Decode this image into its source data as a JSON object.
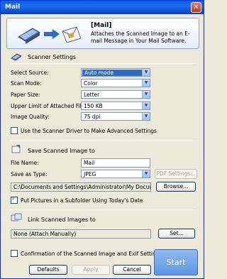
{
  "window": {
    "title": "Mail",
    "close_glyph": "✕"
  },
  "header": {
    "title": "[Mail]",
    "description": "Attaches the Scanned Image to an E-mail Message in Your Mail Software.",
    "scanner_icon": "scanner-icon",
    "arrow_icon": "arrow-right-icon",
    "mail_icon": "mail-envelope-icon"
  },
  "scanner_settings": {
    "heading": "Scanner Settings",
    "select_source": {
      "label": "Select Source:",
      "value": "Auto mode"
    },
    "scan_mode": {
      "label": "Scan Mode:",
      "value": "Color"
    },
    "paper_size": {
      "label": "Paper Size:",
      "value": "Letter"
    },
    "upper_limit": {
      "label": "Upper Limit of Attached File:",
      "value": "150 KB"
    },
    "image_quality": {
      "label": "Image Quality:",
      "value": "75 dpi"
    },
    "use_driver_label": "Use the Scanner Driver to Make Advanced Settings",
    "use_driver_checked": false
  },
  "save_settings": {
    "heading": "Save Scanned Image to",
    "file_name": {
      "label": "File Name:",
      "value": "Mail"
    },
    "save_as_type": {
      "label": "Save as Type:",
      "value": "JPEG"
    },
    "pdf_settings_label": "PDF Settings...",
    "save_path": "C:\\Documents and Settings\\Administrator\\My Documents\\My",
    "browse_label": "Browse...",
    "subfolder_label": "Put Pictures in a Subfolder Using Today's Date",
    "subfolder_checked": true
  },
  "link_settings": {
    "heading": "Link Scanned Images to",
    "value": "None (Attach Manually)",
    "set_label": "Set..."
  },
  "footer": {
    "confirm_label": "Confirmation of the Scanned Image and Exif Settings",
    "confirm_checked": false,
    "defaults_label": "Defaults",
    "apply_label": "Apply",
    "cancel_label": "Cancel",
    "start_label": "Start"
  }
}
